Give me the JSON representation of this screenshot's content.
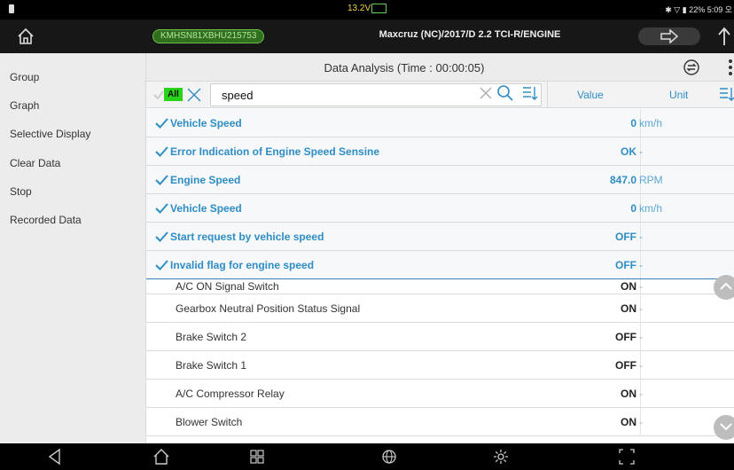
{
  "status_bar": {
    "voltage": "13.2V",
    "right_text": "✱ ▽ ▮ 22% 5:09 오"
  },
  "header": {
    "vin": "KMHSN81XBHU215753",
    "vehicle": "Maxcruz (NC)/2017/D 2.2 TCI-R/ENGINE"
  },
  "sidebar": {
    "items": [
      {
        "label": "Group"
      },
      {
        "label": "Graph"
      },
      {
        "label": "Selective Display"
      },
      {
        "label": "Clear Data"
      },
      {
        "label": "Stop"
      },
      {
        "label": "Recorded Data"
      }
    ]
  },
  "main": {
    "title": "Data Analysis (Time : 00:00:05)"
  },
  "toolbar": {
    "all_label": "All",
    "search_value": "speed",
    "value_header": "Value",
    "unit_header": "Unit"
  },
  "rows": [
    {
      "name": "Vehicle Speed",
      "value": "0",
      "unit": "km/h"
    },
    {
      "name": "Error Indication of Engine Speed Sensine",
      "value": "OK",
      "unit": "-"
    },
    {
      "name": "Engine Speed",
      "value": "847.0",
      "unit": "RPM"
    },
    {
      "name": "Vehicle Speed",
      "value": "0",
      "unit": "km/h"
    },
    {
      "name": "Start request by vehicle speed",
      "value": "OFF",
      "unit": "-"
    },
    {
      "name": "Invalid flag for engine speed",
      "value": "OFF",
      "unit": "-"
    },
    {
      "name": "A/C ON Signal Switch",
      "value": "ON",
      "unit": "-"
    },
    {
      "name": "Gearbox Neutral Position Status Signal",
      "value": "ON",
      "unit": "-"
    },
    {
      "name": "Brake Switch 2",
      "value": "OFF",
      "unit": "-"
    },
    {
      "name": "Brake Switch 1",
      "value": "OFF",
      "unit": "-"
    },
    {
      "name": "A/C Compressor Relay",
      "value": "ON",
      "unit": "-"
    },
    {
      "name": "Blower Switch",
      "value": "ON",
      "unit": "-"
    }
  ],
  "colors": {
    "accent": "#2f8dc4",
    "vin_pill": "#2f6f1e",
    "all_badge": "#2ad21a"
  },
  "icons": [
    "home-icon",
    "arrow-right-icon",
    "back-arrow-icon",
    "refresh-icon",
    "more-vert-icon",
    "check-icon",
    "close-icon",
    "search-icon",
    "sort-icon",
    "chevron-up-icon",
    "chevron-down-icon",
    "nav-back-icon",
    "nav-home-icon",
    "nav-apps-icon",
    "nav-globe-icon",
    "nav-settings-icon",
    "nav-capture-icon"
  ]
}
